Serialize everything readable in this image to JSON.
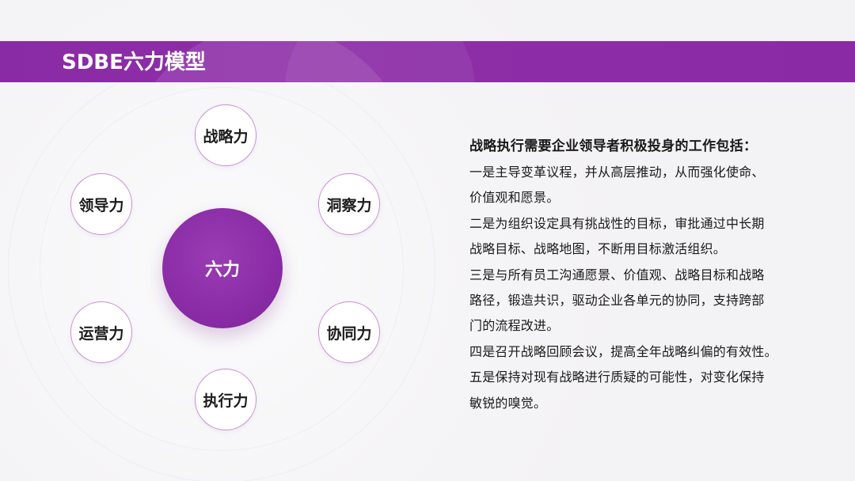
{
  "title": "SDBE六力模型",
  "diagram": {
    "center": "六力",
    "nodes": [
      {
        "key": "strategy",
        "label": "战略力"
      },
      {
        "key": "insight",
        "label": "洞察力"
      },
      {
        "key": "synergy",
        "label": "协同力"
      },
      {
        "key": "execution",
        "label": "执行力"
      },
      {
        "key": "operation",
        "label": "运营力"
      },
      {
        "key": "leadership",
        "label": "领导力"
      }
    ]
  },
  "text": {
    "heading": "战略执行需要企业领导者积极投身的工作包括：",
    "lines": [
      "一是主导变革议程，并从高层推动，从而强化使命、",
      "价值观和愿景。",
      "二是为组织设定具有挑战性的目标，审批通过中长期",
      "战略目标、战略地图，不断用目标激活组织。",
      "三是与所有员工沟通愿景、价值观、战略目标和战略",
      "路径，锻造共识，驱动企业各单元的协同，支持跨部",
      "门的流程改进。",
      "四是召开战略回顾会议，提高全年战略纠偏的有效性。",
      "五是保持对现有战略进行质疑的可能性，对变化保持",
      "敏锐的嗅觉。"
    ]
  },
  "colors": {
    "banner": "#8a2ba6",
    "center": "#8a2ca6",
    "node_border": "#c98fd6"
  }
}
